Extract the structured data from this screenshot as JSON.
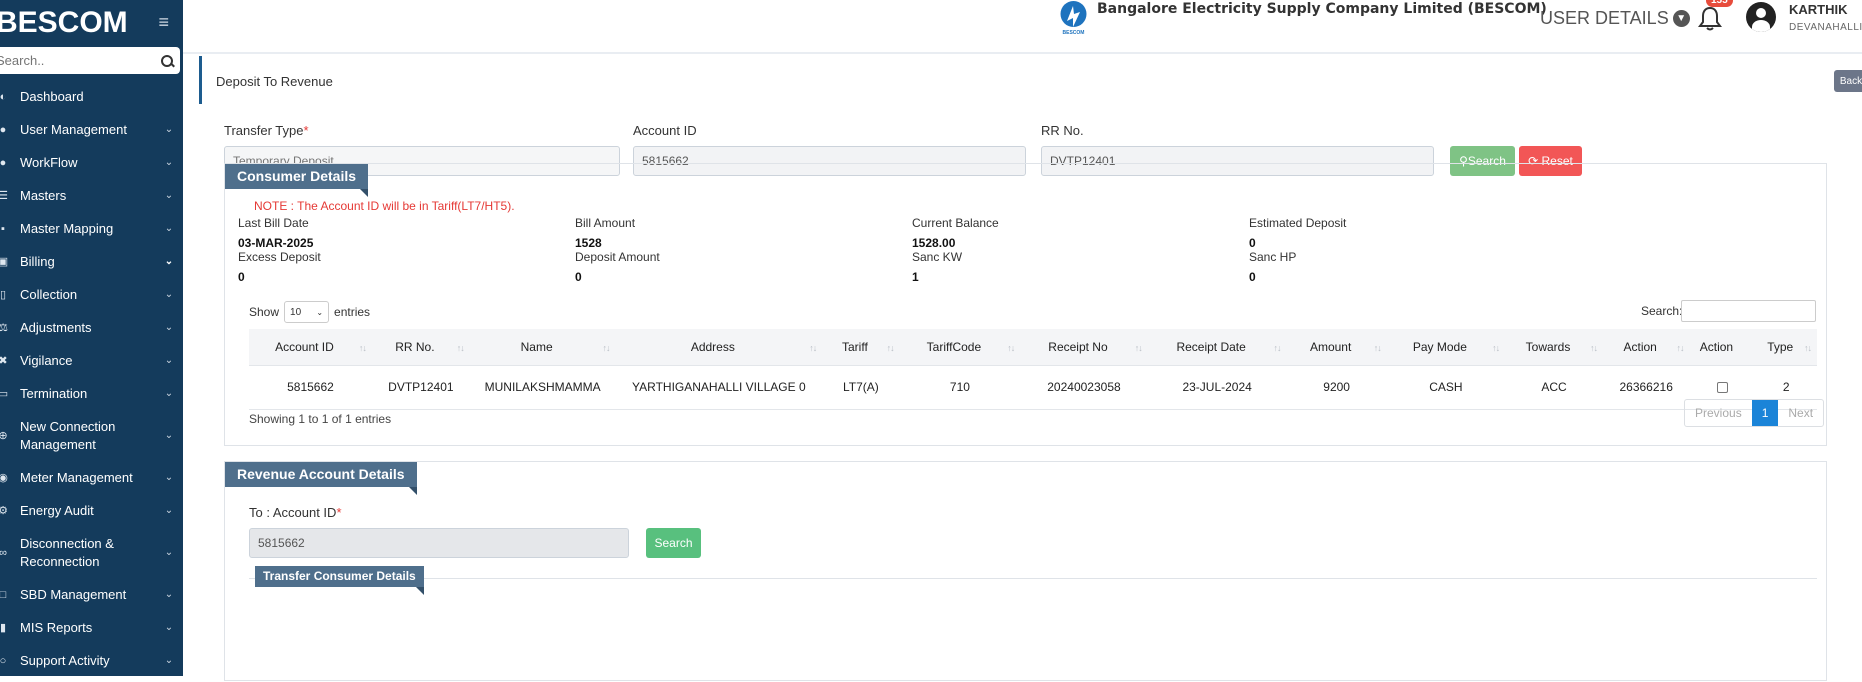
{
  "sidebar": {
    "brand": "BESCOM",
    "search_placeholder": "Search..",
    "items": [
      {
        "label": "Dashboard",
        "icon": "dashboard-icon",
        "chevron": false
      },
      {
        "label": "User Management",
        "icon": "user-icon",
        "chevron": true
      },
      {
        "label": "WorkFlow",
        "icon": "user-icon",
        "chevron": true
      },
      {
        "label": "Masters",
        "icon": "list-icon",
        "chevron": true
      },
      {
        "label": "Master Mapping",
        "icon": "sitemap-icon",
        "chevron": true
      },
      {
        "label": "Billing",
        "icon": "desktop-icon",
        "chevron": true,
        "bold_chevron": true
      },
      {
        "label": "Collection",
        "icon": "file-icon",
        "chevron": true
      },
      {
        "label": "Adjustments",
        "icon": "balance-icon",
        "chevron": true
      },
      {
        "label": "Vigilance",
        "icon": "eye-off-icon",
        "chevron": true
      },
      {
        "label": "Termination",
        "icon": "trash-icon",
        "chevron": true
      },
      {
        "label": "New Connection Management",
        "icon": "plus-circle-icon",
        "chevron": true,
        "tall": true
      },
      {
        "label": "Meter Management",
        "icon": "meter-icon",
        "chevron": true
      },
      {
        "label": "Energy Audit",
        "icon": "cogs-icon",
        "chevron": true
      },
      {
        "label": "Disconnection & Reconnection",
        "icon": "link-icon",
        "chevron": true,
        "tall": true
      },
      {
        "label": "SBD Management",
        "icon": "box-icon",
        "chevron": true
      },
      {
        "label": "MIS Reports",
        "icon": "chart-icon",
        "chevron": true
      },
      {
        "label": "Support Activity",
        "icon": "headset-icon",
        "chevron": true
      }
    ]
  },
  "header": {
    "company": "Bangalore Electricity Supply Company Limited (BESCOM)",
    "logo_text": "BESCOM",
    "user_details": "USER DETAILS",
    "notification_count": "155",
    "user_name": "KARTHIK",
    "user_location": "DEVANAHALLI"
  },
  "page": {
    "title": "Deposit To Revenue",
    "back": "Back"
  },
  "form": {
    "transfer_type_label": "Transfer Type",
    "transfer_type_placeholder": "Temporary Deposit",
    "account_id_label": "Account ID",
    "account_id_value": "5815662",
    "rr_no_label": "RR No.",
    "rr_no_value": "DVTP12401",
    "search": "Search",
    "reset": "Reset",
    "required_mark": "*"
  },
  "consumer": {
    "title": "Consumer Details",
    "note": "NOTE : The Account ID will be in Tariff(LT7/HT5).",
    "fields": [
      {
        "label": "Last Bill Date",
        "value": "03-MAR-2025"
      },
      {
        "label": "Bill Amount",
        "value": "1528"
      },
      {
        "label": "Current Balance",
        "value": "1528.00"
      },
      {
        "label": "Estimated Deposit",
        "value": "0"
      },
      {
        "label": "Excess Deposit",
        "value": "0"
      },
      {
        "label": "Deposit Amount",
        "value": "0"
      },
      {
        "label": "Sanc KW",
        "value": "1"
      },
      {
        "label": "Sanc HP",
        "value": "0"
      }
    ],
    "show_label": "Show",
    "entries_count": "10",
    "entries_label": "entries",
    "search_label": "Search:",
    "columns": [
      "Account ID",
      "RR No.",
      "Name",
      "Address",
      "Tariff",
      "TariffCode",
      "Receipt No",
      "Receipt Date",
      "Amount",
      "Pay Mode",
      "Towards",
      "Action",
      "Action",
      "Type"
    ],
    "rows": [
      [
        "5815662",
        "DVTP12401",
        "MUNILAKSHMAMMA",
        "YARTHIGANAHALLI VILLAGE 0",
        "LT7(A)",
        "710",
        "20240023058",
        "23-JUL-2024",
        "9200",
        "CASH",
        "ACC",
        "26366216",
        "",
        "2"
      ]
    ],
    "info": "Showing 1 to 1 of 1 entries",
    "pager": {
      "previous": "Previous",
      "current": "1",
      "next": "Next"
    }
  },
  "revenue": {
    "title": "Revenue Account Details",
    "to_account_label": "To : Account ID",
    "to_account_value": "5815662",
    "search": "Search",
    "sub_title": "Transfer Consumer Details"
  }
}
